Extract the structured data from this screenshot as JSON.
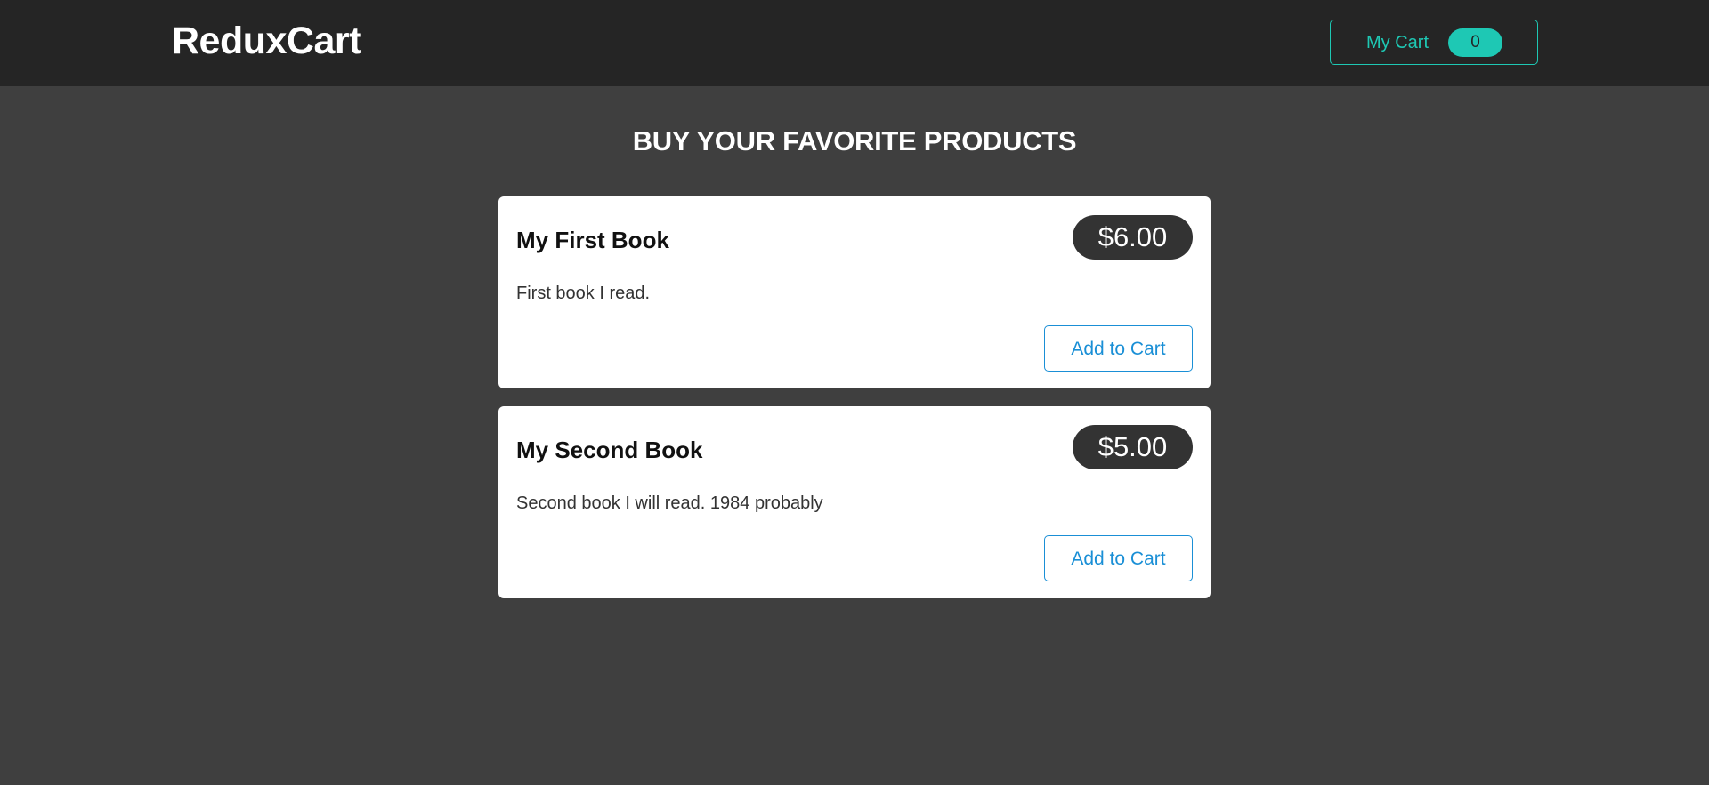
{
  "header": {
    "logo": "ReduxCart",
    "cart_label": "My Cart",
    "cart_count": "0"
  },
  "main": {
    "heading": "BUY YOUR FAVORITE PRODUCTS",
    "products": [
      {
        "title": "My First Book",
        "price": "$6.00",
        "description": "First book I read.",
        "add_label": "Add to Cart"
      },
      {
        "title": "My Second Book",
        "price": "$5.00",
        "description": "Second book I will read. 1984 probably",
        "add_label": "Add to Cart"
      }
    ]
  },
  "colors": {
    "header_bg": "#252525",
    "page_bg": "#3f3f3f",
    "accent_teal": "#1ec8b4",
    "link_blue": "#1a8fd6",
    "price_bg": "#333333"
  }
}
